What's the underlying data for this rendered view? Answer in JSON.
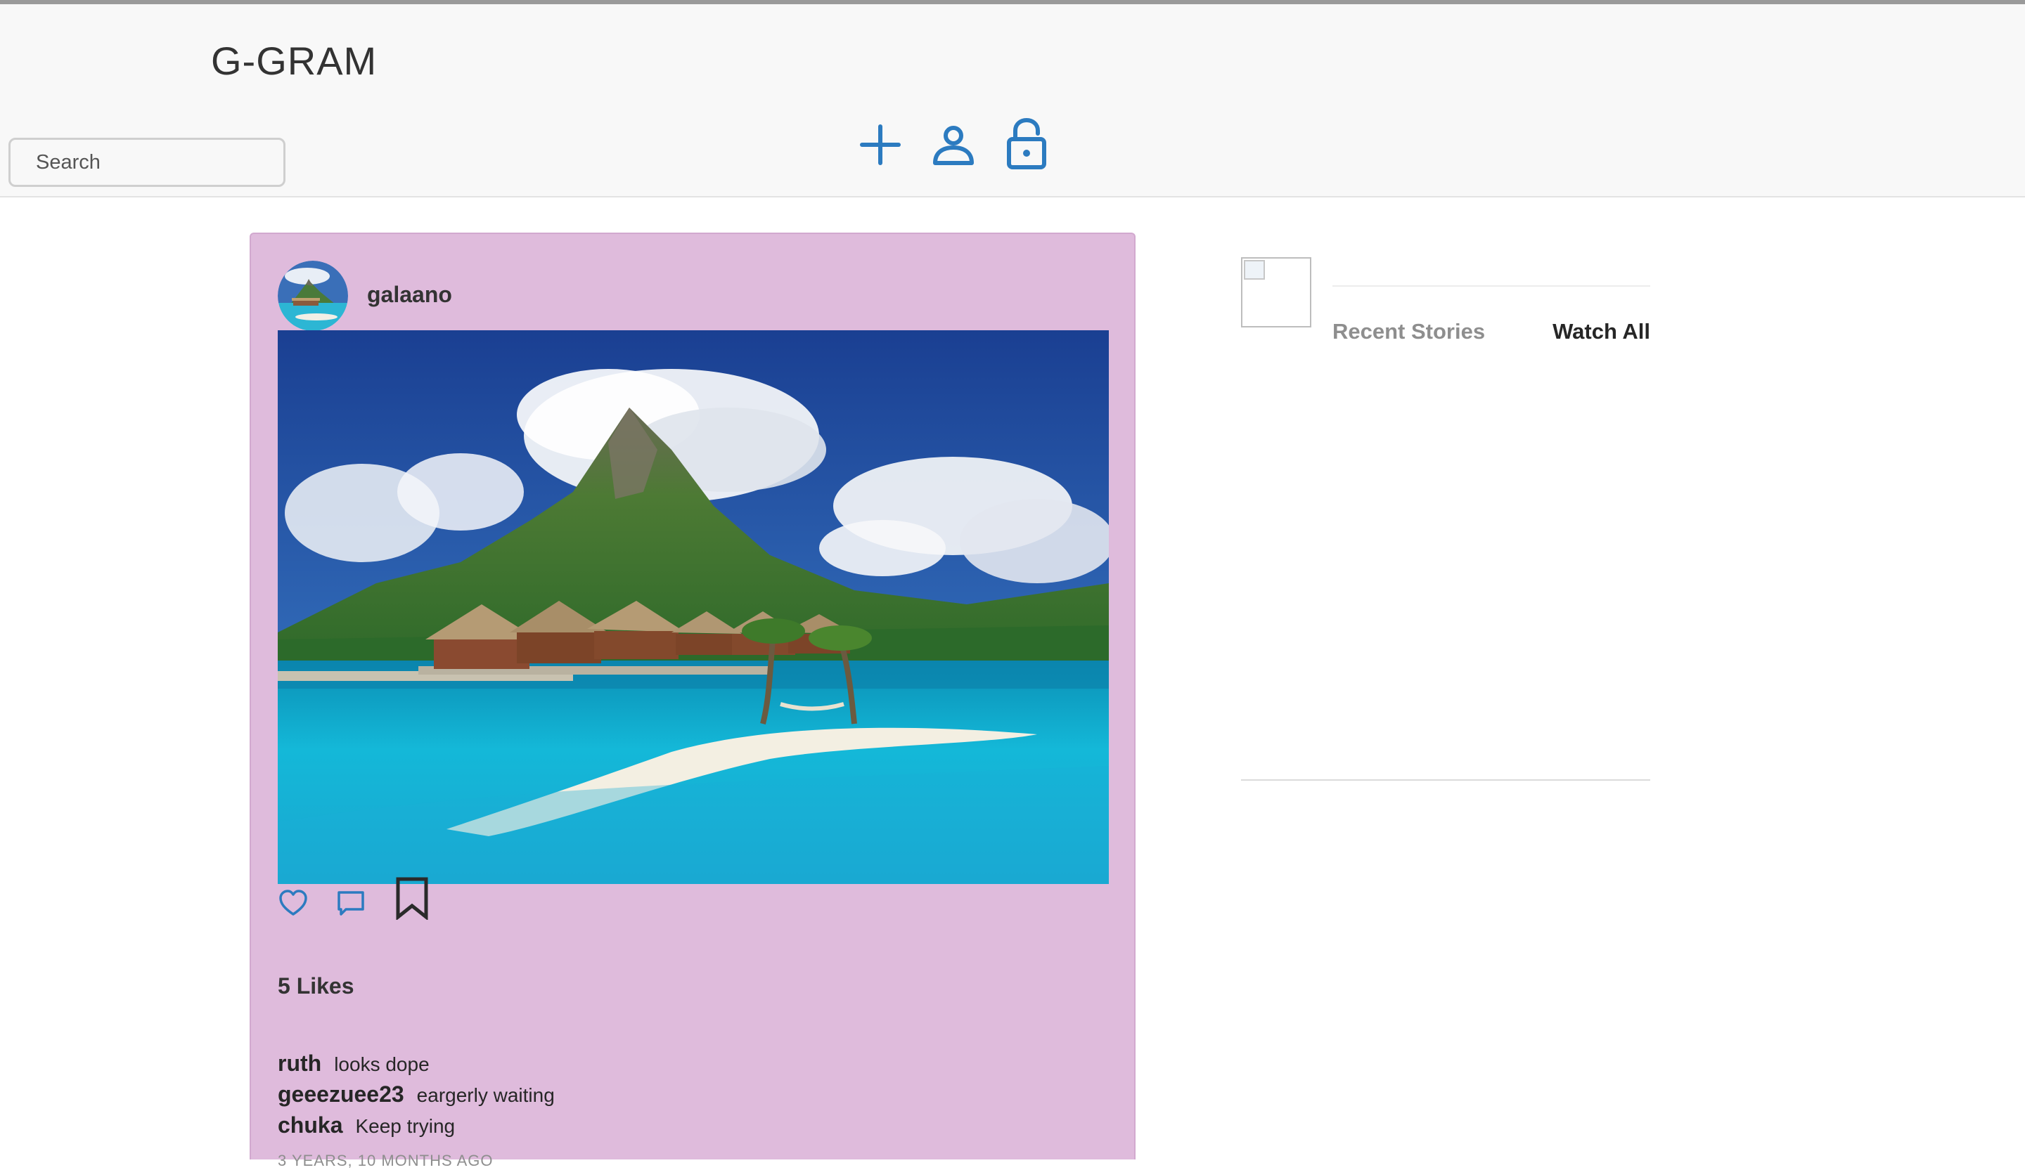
{
  "app": {
    "brand": "G-GRAM",
    "accent_color": "#2c7bc0"
  },
  "navbar": {
    "search_placeholder": "Search",
    "icons": [
      "plus-icon",
      "user-icon",
      "unlock-icon"
    ]
  },
  "post": {
    "username": "galaano",
    "image_alt": "Overwater bungalows in front of a tropical mountain",
    "likes_text": "5 Likes",
    "comments": [
      {
        "user": "ruth",
        "text": "looks dope"
      },
      {
        "user": "geeezuee23",
        "text": "eargerly waiting"
      },
      {
        "user": "chuka",
        "text": "Keep trying"
      }
    ],
    "timestamp": "3 YEARS, 10 MONTHS AGO",
    "action_icons": [
      "heart-icon",
      "comment-icon",
      "bookmark-icon"
    ]
  },
  "sidebar": {
    "recent_stories_label": "Recent Stories",
    "watch_all_label": "Watch All"
  }
}
